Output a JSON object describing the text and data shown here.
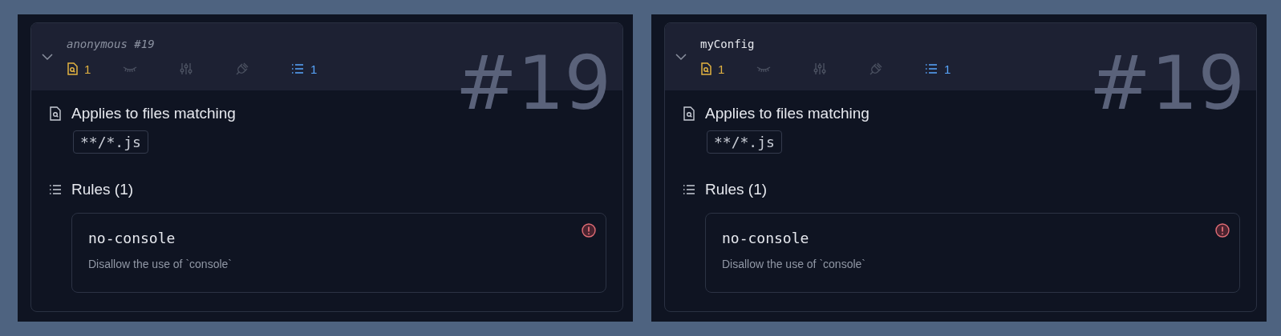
{
  "configs": [
    {
      "title": "anonymous #19",
      "anonymous": true,
      "expanded": true,
      "index_label": "#19",
      "badges": [
        {
          "kind": "files",
          "active": true,
          "count": "1"
        },
        {
          "kind": "ignores",
          "active": false
        },
        {
          "kind": "options",
          "active": false
        },
        {
          "kind": "plugins",
          "active": false
        },
        {
          "kind": "rules",
          "active": true,
          "count": "1"
        }
      ],
      "files_heading": "Applies to files matching",
      "patterns": [
        "**/*.js"
      ],
      "rules_heading": "Rules (1)",
      "rules": [
        {
          "name": "no-console",
          "description": "Disallow the use of `console`",
          "kind": "error"
        }
      ]
    },
    {
      "title": "myConfig",
      "anonymous": false,
      "expanded": true,
      "index_label": "#19",
      "badges": [
        {
          "kind": "files",
          "active": true,
          "count": "1"
        },
        {
          "kind": "ignores",
          "active": false
        },
        {
          "kind": "options",
          "active": false
        },
        {
          "kind": "plugins",
          "active": false
        },
        {
          "kind": "rules",
          "active": true,
          "count": "1"
        }
      ],
      "files_heading": "Applies to files matching",
      "patterns": [
        "**/*.js"
      ],
      "rules_heading": "Rules (1)",
      "rules": [
        {
          "name": "no-console",
          "description": "Disallow the use of `console`",
          "kind": "error"
        }
      ]
    }
  ]
}
